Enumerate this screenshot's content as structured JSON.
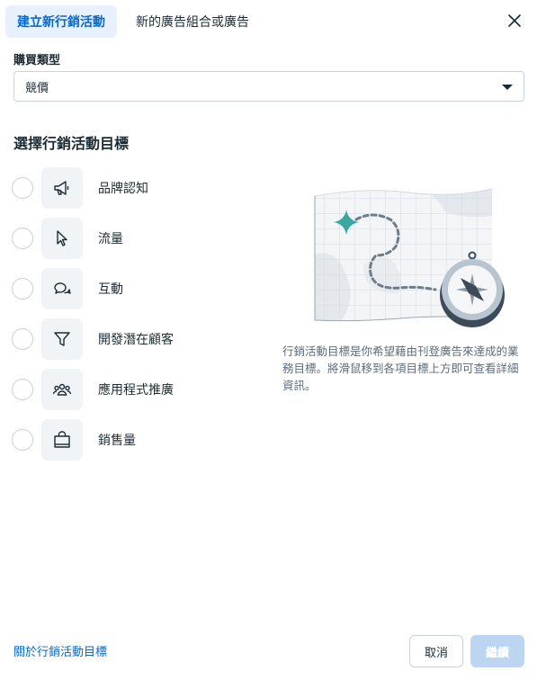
{
  "tabs": [
    {
      "label": "建立新行銷活動",
      "active": true
    },
    {
      "label": "新的廣告組合或廣告",
      "active": false
    }
  ],
  "buying_type": {
    "label": "購買類型",
    "value": "競價"
  },
  "section_title": "選擇行銷活動目標",
  "objectives": [
    {
      "label": "品牌認知",
      "icon": "megaphone-icon"
    },
    {
      "label": "流量",
      "icon": "cursor-icon"
    },
    {
      "label": "互動",
      "icon": "chat-bubbles-icon"
    },
    {
      "label": "開發潛在顧客",
      "icon": "funnel-icon"
    },
    {
      "label": "應用程式推廣",
      "icon": "people-icon"
    },
    {
      "label": "銷售量",
      "icon": "shopping-bag-icon"
    }
  ],
  "description": "行銷活動目標是你希望藉由刊登廣告來達成的業務目標。將滑鼠移到各項目標上方即可查看詳細資訊。",
  "footer": {
    "learn_link": "關於行銷活動目標",
    "cancel": "取消",
    "continue": "繼續"
  },
  "colors": {
    "accent": "#0a69c4",
    "tab_active_bg": "#e7f1fd",
    "teal": "#3aa7a3"
  }
}
